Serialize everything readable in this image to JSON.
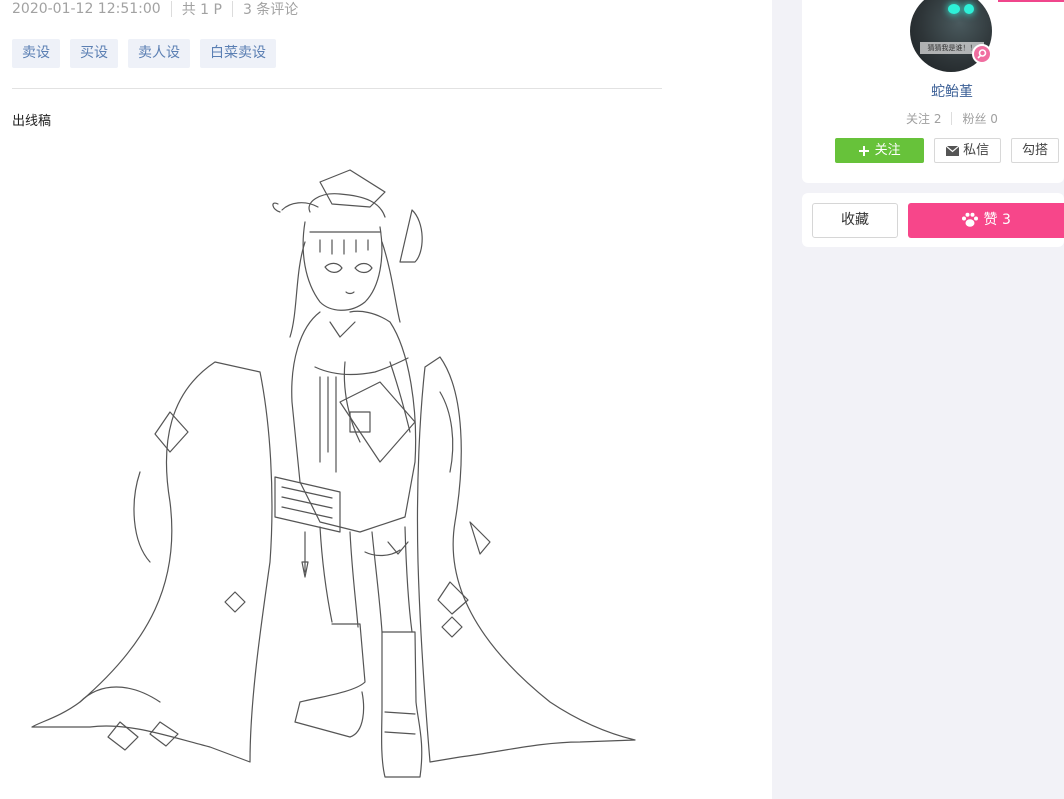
{
  "post": {
    "date": "2020-01-12 12:51:00",
    "pages": "共 1 P",
    "comments": "3 条评论",
    "tags": [
      "卖设",
      "买设",
      "卖人设",
      "白菜卖设"
    ],
    "description": "出线稿"
  },
  "author": {
    "name": "蛇鲐堇",
    "following": "关注 2",
    "followers": "粉丝 0",
    "avatar_caption": "猜猜我是谁！！",
    "follow_label": "关注",
    "message_label": "私信",
    "hook_label": "勾搭"
  },
  "actions": {
    "favorite_label": "收藏",
    "like_label": "赞 3"
  },
  "colors": {
    "accent_pink": "#f7468a",
    "follow_green": "#67c23a",
    "tag_text": "#5b7fb3",
    "link_blue": "#3b5f96"
  },
  "icons": {
    "follow": "plus-icon",
    "message": "mail-icon",
    "like": "paw-icon",
    "badge": "search-badge-icon"
  }
}
